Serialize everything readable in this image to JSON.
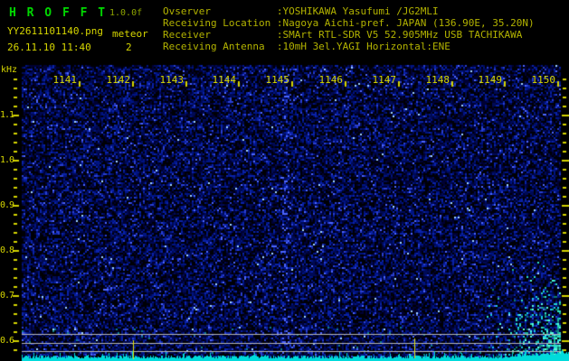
{
  "header": {
    "app_title": "H R O F F T",
    "version": "1.0.0f",
    "filename": "YY2611101140.png",
    "datetime": "26.11.10 11:40",
    "meteor_label": "meteor",
    "meteor_count": "2",
    "info": [
      "Ovserver           :YOSHIKAWA Yasufumi /JG2MLI",
      "Receiving Location :Nagoya Aichi-pref. JAPAN (136.90E, 35.20N)",
      "Receiver           :SMArt RTL-SDR V5 52.905MHz USB TACHIKAWA",
      "Receiving Antenna  :10mH 3el.YAGI Horizontal:ENE"
    ]
  },
  "chart_data": {
    "type": "heatmap",
    "title": "",
    "x_axis": {
      "position": "top",
      "tick_labels": [
        "1141",
        "1142",
        "1143",
        "1144",
        "1145",
        "1146",
        "1147",
        "1148",
        "1149",
        "1150"
      ]
    },
    "y_axis": {
      "unit_label": "kHz",
      "tick_labels": [
        "1.1",
        "1.0",
        "0.9",
        "0.8",
        "0.7",
        "0.6"
      ],
      "minor_tick_step_khz": 0.02,
      "direction": "values decrease downward"
    },
    "reference_lines_khz": [
      0.62,
      0.6,
      0.58
    ],
    "meteor_markers": [
      {
        "time": "11:42",
        "x_frac": 0.206
      },
      {
        "time": "11:47",
        "x_frac": 0.728
      }
    ],
    "features": [
      "faint vertical brighter band at 11:45",
      "dense cyan-green speckle cluster in lower-right corner (after ~11:49, below ~0.75 kHz)",
      "cyan signal-level trace along bottom edge"
    ],
    "legend": "none",
    "grid": "off"
  },
  "colors": {
    "background": "#000000",
    "title_green": "#00d800",
    "version_olive": "#8ea400",
    "label_yellow": "#d6d600",
    "info_yellow": "#b3b300",
    "tick_yellow": "#d4d400",
    "reference_line_gray": "#b7b7b7",
    "level_trace_cyan": "#00dbdb",
    "meteor_mark_yellow": "#e8e800",
    "noise_palette": [
      "#000005",
      "#000133",
      "#000a55",
      "#001483",
      "#0a22a8",
      "#2a3fd0",
      "#4d66ff",
      "#9fd4ff"
    ],
    "hotspot_palette": [
      "#0b7a6e",
      "#19b39b",
      "#2fe0c2",
      "#59ffd9",
      "#18cdeb"
    ]
  }
}
